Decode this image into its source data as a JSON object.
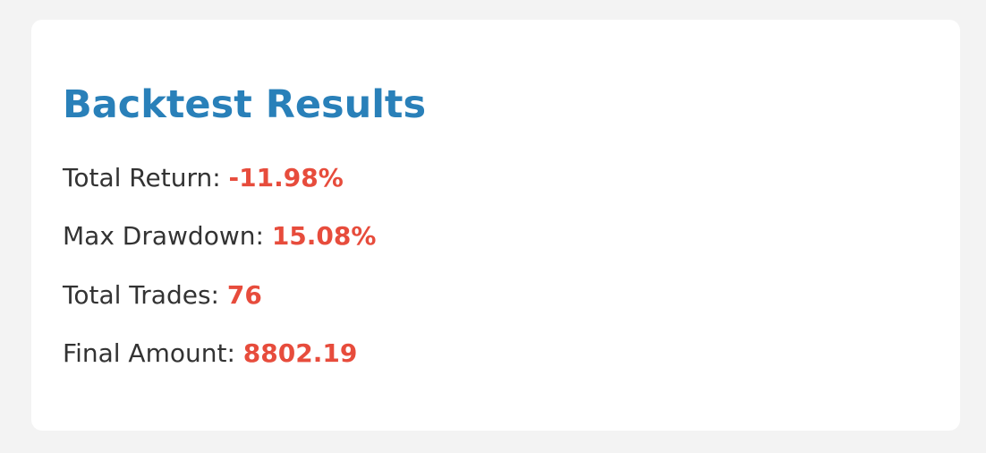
{
  "results": {
    "title": "Backtest Results",
    "metrics": [
      {
        "label": "Total Return: ",
        "value": "-11.98%"
      },
      {
        "label": "Max Drawdown: ",
        "value": "15.08%"
      },
      {
        "label": "Total Trades: ",
        "value": "76"
      },
      {
        "label": "Final Amount: ",
        "value": "8802.19"
      }
    ]
  },
  "colors": {
    "background": "#f3f3f3",
    "card": "#ffffff",
    "title": "#2980b9",
    "text": "#333333",
    "value": "#e74c3c"
  }
}
